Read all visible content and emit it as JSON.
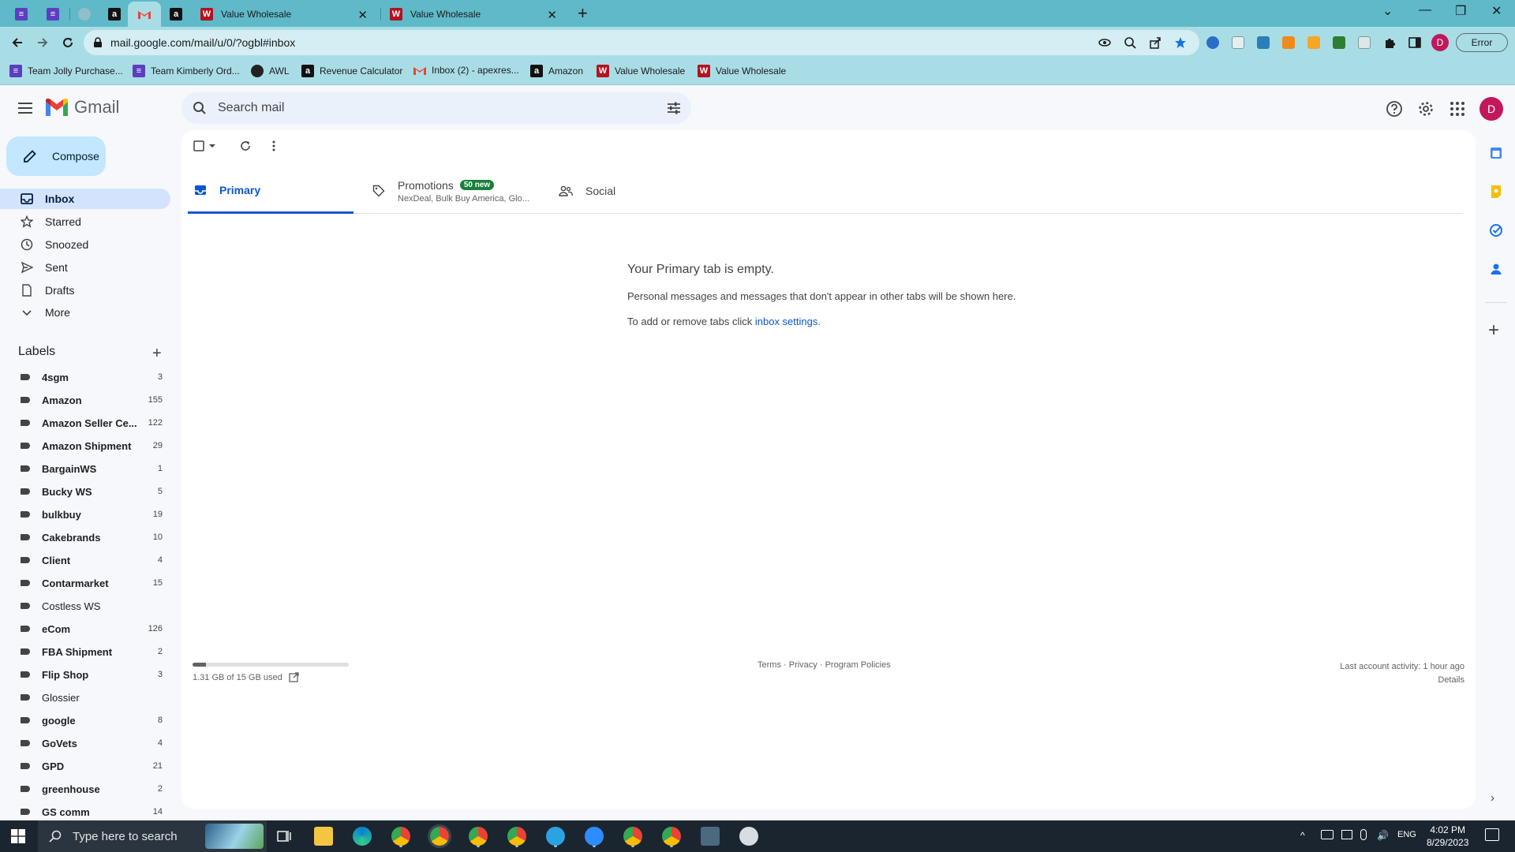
{
  "browser": {
    "tabs": [
      {
        "title": "Value Wholesale"
      },
      {
        "title": "Value Wholesale"
      }
    ],
    "url": "mail.google.com/mail/u/0/?ogbl#inbox",
    "error_label": "Error",
    "profile_initial": "D"
  },
  "bookmarks": [
    {
      "label": "Team Jolly Purchase...",
      "icon": "tasks-icon",
      "color": "#5b3fbf"
    },
    {
      "label": "Team Kimberly Ord...",
      "icon": "tasks-icon",
      "color": "#5b3fbf"
    },
    {
      "label": "AWL",
      "icon": "globe-icon",
      "color": "#222222"
    },
    {
      "label": "Revenue Calculator",
      "icon": "amazon-icon",
      "color": "#111111"
    },
    {
      "label": "Inbox (2) - apexres...",
      "icon": "gmail-icon",
      "color": "#ea4335"
    },
    {
      "label": "Amazon",
      "icon": "amazon-icon",
      "color": "#111111"
    },
    {
      "label": "Value Wholesale",
      "icon": "vw-icon",
      "color": "#b4121e"
    },
    {
      "label": "Value Wholesale",
      "icon": "vw-icon",
      "color": "#b4121e"
    }
  ],
  "gmail": {
    "app_name": "Gmail",
    "search_placeholder": "Search mail",
    "avatar_initial": "D",
    "compose_label": "Compose",
    "nav": [
      {
        "label": "Inbox",
        "icon": "inbox-icon",
        "active": true
      },
      {
        "label": "Starred",
        "icon": "star-icon"
      },
      {
        "label": "Snoozed",
        "icon": "clock-icon"
      },
      {
        "label": "Sent",
        "icon": "send-icon"
      },
      {
        "label": "Drafts",
        "icon": "draft-icon"
      },
      {
        "label": "More",
        "icon": "chevron-down-icon"
      }
    ],
    "labels_title": "Labels",
    "labels": [
      {
        "name": "4sgm",
        "count": "3",
        "bold": true
      },
      {
        "name": "Amazon",
        "count": "155",
        "bold": true
      },
      {
        "name": "Amazon Seller Ce...",
        "count": "122",
        "bold": true
      },
      {
        "name": "Amazon Shipment",
        "count": "29",
        "bold": true
      },
      {
        "name": "BargainWS",
        "count": "1",
        "bold": true
      },
      {
        "name": "Bucky WS",
        "count": "5",
        "bold": true
      },
      {
        "name": "bulkbuy",
        "count": "19",
        "bold": true
      },
      {
        "name": "Cakebrands",
        "count": "10",
        "bold": true
      },
      {
        "name": "Client",
        "count": "4",
        "bold": true
      },
      {
        "name": "Contarmarket",
        "count": "15",
        "bold": true
      },
      {
        "name": "Costless WS",
        "count": "",
        "bold": false
      },
      {
        "name": "eCom",
        "count": "126",
        "bold": true
      },
      {
        "name": "FBA Shipment",
        "count": "2",
        "bold": true
      },
      {
        "name": "Flip Shop",
        "count": "3",
        "bold": true
      },
      {
        "name": "Glossier",
        "count": "",
        "bold": false
      },
      {
        "name": "google",
        "count": "8",
        "bold": true
      },
      {
        "name": "GoVets",
        "count": "4",
        "bold": true
      },
      {
        "name": "GPD",
        "count": "21",
        "bold": true
      },
      {
        "name": "greenhouse",
        "count": "2",
        "bold": true
      },
      {
        "name": "GS comm",
        "count": "14",
        "bold": true
      }
    ],
    "category_tabs": [
      {
        "label": "Primary",
        "icon": "inbox-icon",
        "active": true
      },
      {
        "label": "Promotions",
        "icon": "tag-icon",
        "badge": "50 new",
        "snippet": "NexDeal, Bulk Buy America, Glo..."
      },
      {
        "label": "Social",
        "icon": "people-icon"
      }
    ],
    "empty": {
      "title": "Your Primary tab is empty.",
      "description": "Personal messages and messages that don't appear in other tabs will be shown here.",
      "add_prefix": "To add or remove tabs click ",
      "add_link": "inbox settings",
      "add_suffix": "."
    },
    "storage": {
      "text": "1.31 GB of 15 GB used",
      "fraction": 0.087
    },
    "footer": {
      "terms": "Terms",
      "privacy": "Privacy",
      "policies": "Program Policies",
      "sep": " · "
    },
    "activity": {
      "text": "Last account activity: 1 hour ago",
      "details": "Details"
    }
  },
  "taskbar": {
    "search_placeholder": "Type here to search",
    "lang": "ENG",
    "time": "4:02 PM",
    "date": "8/29/2023"
  }
}
